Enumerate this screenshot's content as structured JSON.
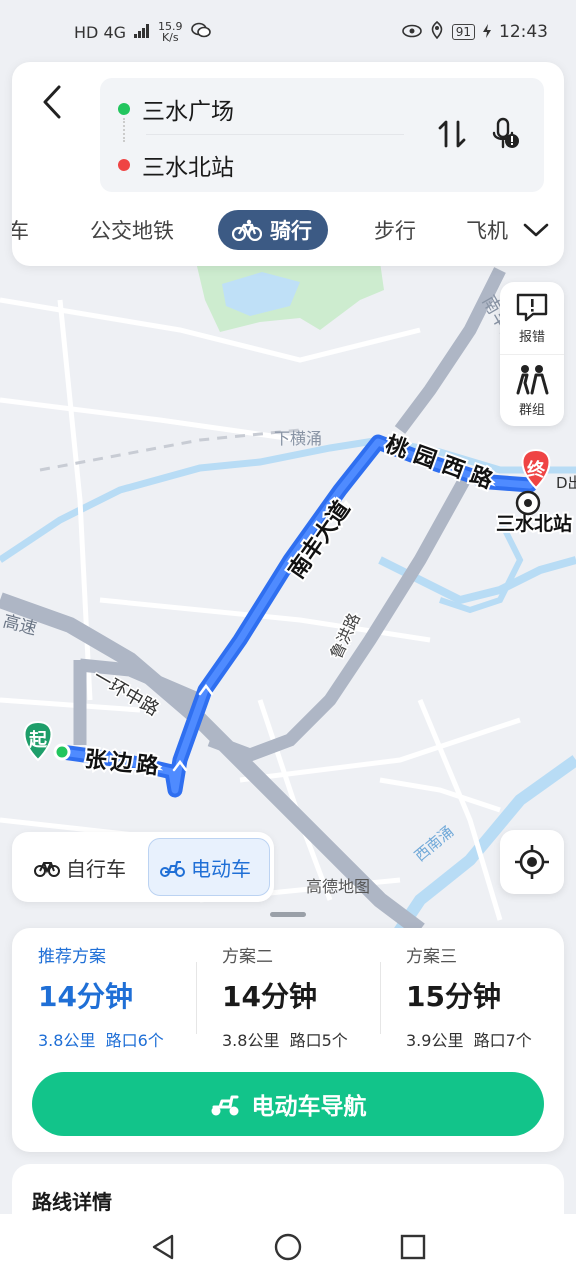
{
  "status_bar": {
    "network": "HD 4G",
    "speed_value": "15.9",
    "speed_unit": "K/s",
    "battery": "91",
    "time": "12:43"
  },
  "route": {
    "start": "三水广场",
    "end": "三水北站"
  },
  "mode_tabs": [
    {
      "label": "车"
    },
    {
      "label": "公交地铁"
    },
    {
      "label": "骑行"
    },
    {
      "label": "步行"
    },
    {
      "label": "飞机"
    }
  ],
  "side_tools": {
    "report_label": "报错",
    "group_label": "群组"
  },
  "map_labels": {
    "nanfeng_vertical": "南丰大道",
    "nanfeng_route": "南丰大道",
    "taoyuan": "桃园西路",
    "xiahengchong": "下横涌",
    "sanshui_north": "三水北站",
    "gaosu": "高速",
    "yihuan": "一环中路",
    "zhangbian": "张边路",
    "luhong": "鲁洪路",
    "xinanchong": "西南涌",
    "gaode": "高德地图",
    "start_marker": "起",
    "end_marker": "终",
    "d_label": "D出"
  },
  "vehicle_toggle": {
    "bike_label": "自行车",
    "ebike_label": "电动车"
  },
  "plans": [
    {
      "name": "推荐方案",
      "time": "14分钟",
      "distance": "3.8公里",
      "junctions": "路口6个"
    },
    {
      "name": "方案二",
      "time": "14分钟",
      "distance": "3.8公里",
      "junctions": "路口5个"
    },
    {
      "name": "方案三",
      "time": "15分钟",
      "distance": "3.9公里",
      "junctions": "路口7个"
    }
  ],
  "nav_button_label": "电动车导航",
  "details_title": "路线详情",
  "colors": {
    "accent_blue": "#1f6fd6",
    "route_blue": "#2f6ff0",
    "nav_green": "#12c48a",
    "active_tab_bg": "#3c5a84",
    "end_red": "#ef4444",
    "start_green": "#22c55e"
  }
}
